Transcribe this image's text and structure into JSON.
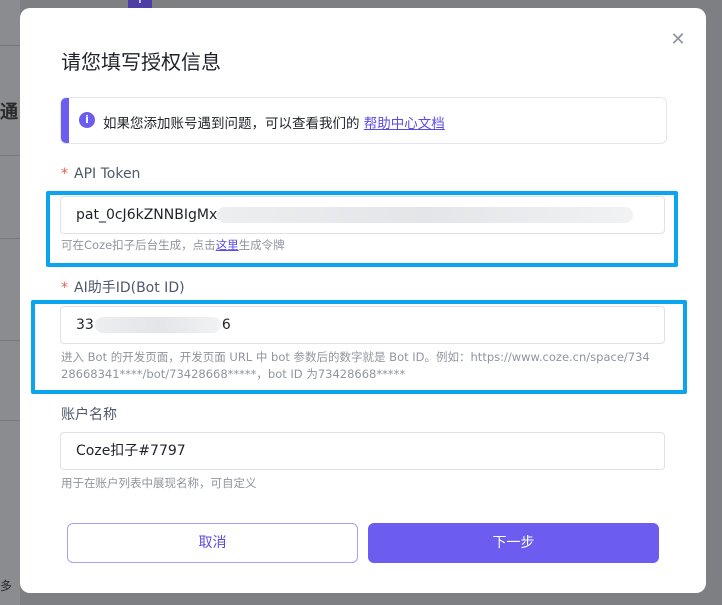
{
  "background": {
    "left_text": "通",
    "bottom_text": "多",
    "plus_icon": "plus-icon"
  },
  "dialog": {
    "title": "请您填写授权信息",
    "close_icon": "close-icon",
    "notice": {
      "icon": "info-icon",
      "text": "如果您添加账号遇到问题，可以查看我们的 ",
      "link": "帮助中心文档"
    },
    "api_token": {
      "required_mark": "*",
      "label": "API Token",
      "value": "pat_0cJ6kZNNBIgMx",
      "hint_prefix": "可在Coze扣子后台生成，点击",
      "hint_link": "这里",
      "hint_suffix": "生成令牌"
    },
    "bot_id": {
      "required_mark": "*",
      "label": "AI助手ID(Bot ID)",
      "value_start": "33",
      "value_end": "6",
      "hint_line1": "进入 Bot 的开发页面，开发页面 URL 中 bot 参数后的数字就是 Bot ID。例如：https://www.coze.cn/space/734",
      "hint_line2": "28668341****/bot/73428668*****，bot ID 为73428668*****"
    },
    "account_name": {
      "label": "账户名称",
      "value": "Coze扣子#7797",
      "hint": "用于在账户列表中展现名称，可自定义"
    },
    "buttons": {
      "cancel": "取消",
      "next": "下一步"
    },
    "colors": {
      "accent": "#6c5cf0",
      "highlight": "#0aa5ee",
      "required": "#f05a4e"
    }
  }
}
